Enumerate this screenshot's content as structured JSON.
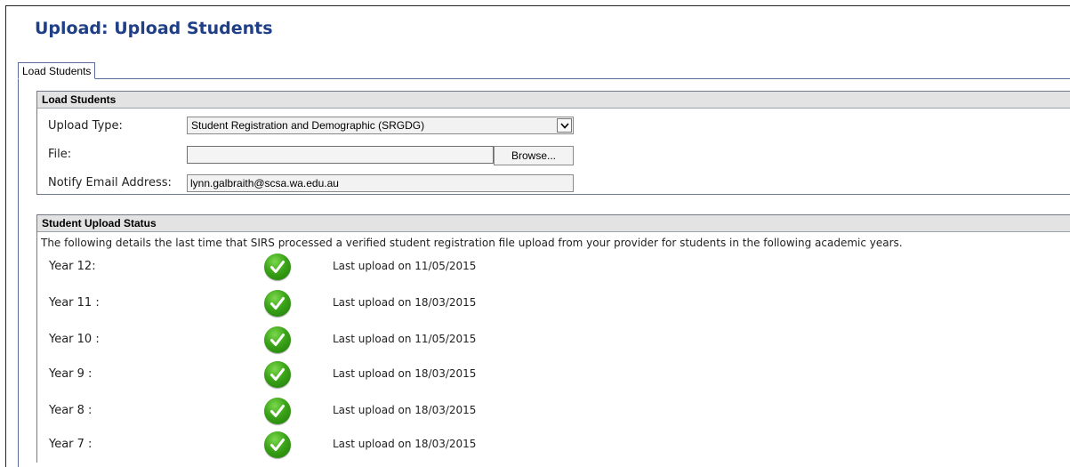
{
  "page": {
    "title": "Upload: Upload Students",
    "tab_label": "Load Students"
  },
  "load_section": {
    "heading": "Load Students",
    "upload_type_label": "Upload Type:",
    "upload_type_value": "Student Registration and Demographic (SRGDG)",
    "file_label": "File:",
    "file_value": "",
    "browse_label": "Browse...",
    "email_label": "Notify Email Address:",
    "email_value": "lynn.galbraith@scsa.wa.edu.au"
  },
  "status_section": {
    "heading": "Student Upload Status",
    "description": "The following details the last time that SIRS processed a verified student registration file upload from your provider for students in the following academic years.",
    "years": [
      {
        "label": "Year 12:",
        "status": "Last upload on 11/05/2015",
        "icon": "check-circle-icon"
      },
      {
        "label": "Year 11 :",
        "status": "Last upload on 18/03/2015",
        "icon": "check-circle-icon"
      },
      {
        "label": "Year 10 :",
        "status": "Last upload on 11/05/2015",
        "icon": "check-circle-icon"
      },
      {
        "label": "Year 9 :",
        "status": "Last upload on 18/03/2015",
        "icon": "check-circle-icon"
      },
      {
        "label": "Year 8 :",
        "status": "Last upload on 18/03/2015",
        "icon": "check-circle-icon"
      },
      {
        "label": "Year 7 :",
        "status": "Last upload on 18/03/2015",
        "icon": "check-circle-icon"
      }
    ]
  },
  "colors": {
    "title": "#1f3f87",
    "section_header_bg": "#e3e3e3",
    "check_green": "#3aa317"
  }
}
